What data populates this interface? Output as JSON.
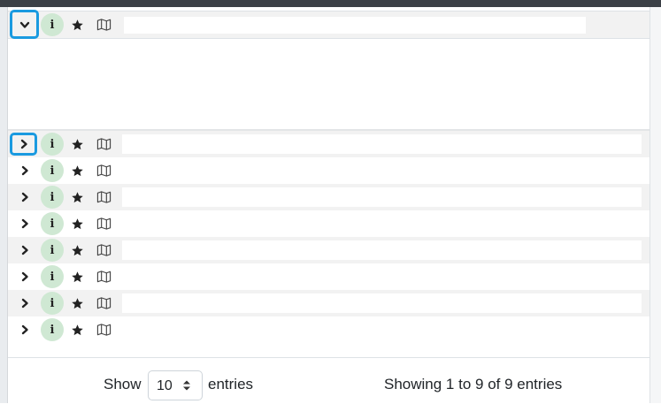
{
  "table": {
    "expanded_row": {
      "toggle_icon": "chevron-down-icon",
      "info_icon_text": "i",
      "star_icon": "star-icon",
      "map_icon": "map-icon"
    },
    "rows": [
      {
        "toggle_icon": "chevron-right-icon",
        "info_icon_text": "i"
      },
      {
        "toggle_icon": "chevron-right-icon",
        "info_icon_text": "i"
      },
      {
        "toggle_icon": "chevron-right-icon",
        "info_icon_text": "i"
      },
      {
        "toggle_icon": "chevron-right-icon",
        "info_icon_text": "i"
      },
      {
        "toggle_icon": "chevron-right-icon",
        "info_icon_text": "i"
      },
      {
        "toggle_icon": "chevron-right-icon",
        "info_icon_text": "i"
      },
      {
        "toggle_icon": "chevron-right-icon",
        "info_icon_text": "i"
      },
      {
        "toggle_icon": "chevron-right-icon",
        "info_icon_text": "i"
      }
    ]
  },
  "footer": {
    "show_label": "Show",
    "page_size_value": "10",
    "entries_label": "entries",
    "info_text": "Showing 1 to 9 of 9 entries"
  },
  "colors": {
    "highlight_border": "#1a9ae0",
    "info_badge_bg": "#cfe8d3",
    "top_bar": "#3b4046"
  }
}
